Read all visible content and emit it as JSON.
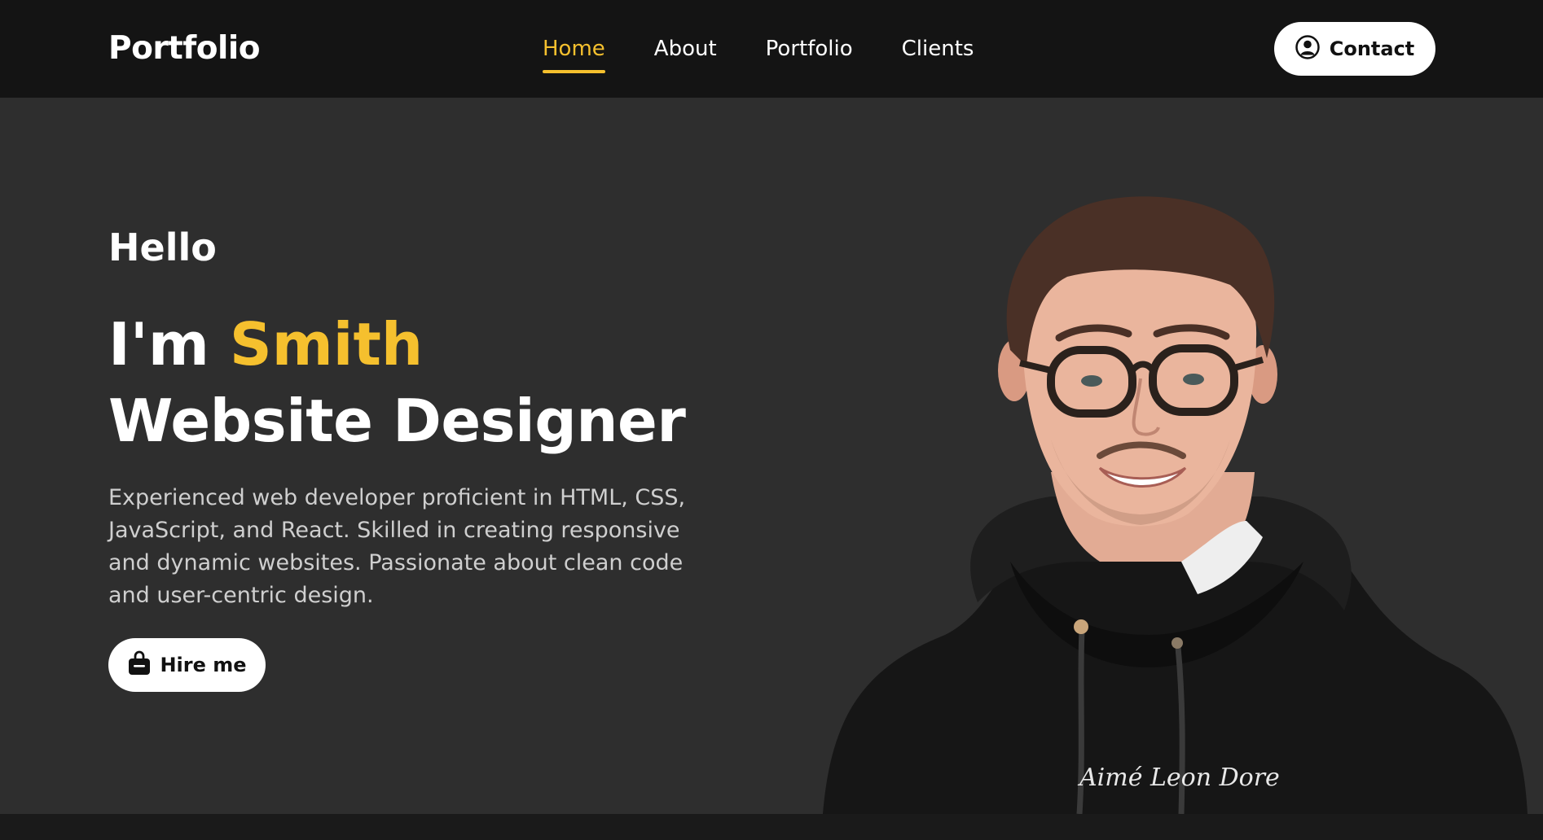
{
  "navbar": {
    "logo": "Portfolio",
    "links": [
      {
        "label": "Home",
        "active": true
      },
      {
        "label": "About",
        "active": false
      },
      {
        "label": "Portfolio",
        "active": false
      },
      {
        "label": "Clients",
        "active": false
      }
    ],
    "contact_label": "Contact",
    "contact_icon": "user-circle-icon"
  },
  "hero": {
    "greeting": "Hello",
    "intro_prefix": "I'm ",
    "name": "Smith",
    "role": "Website Designer",
    "bio": "Experienced web developer proficient in HTML, CSS, JavaScript, and React. Skilled in creating responsive and dynamic websites. Passionate about clean code and user-centric design.",
    "hire_label": "Hire me",
    "hire_icon": "shopping-bag-icon",
    "hoodie_text": "Aimé Leon Dore"
  },
  "colors": {
    "accent": "#f5c02e",
    "navbar_bg": "#141414",
    "hero_bg": "#2e2e2e",
    "text_primary": "#ffffff",
    "text_muted": "#cfcfcf"
  }
}
